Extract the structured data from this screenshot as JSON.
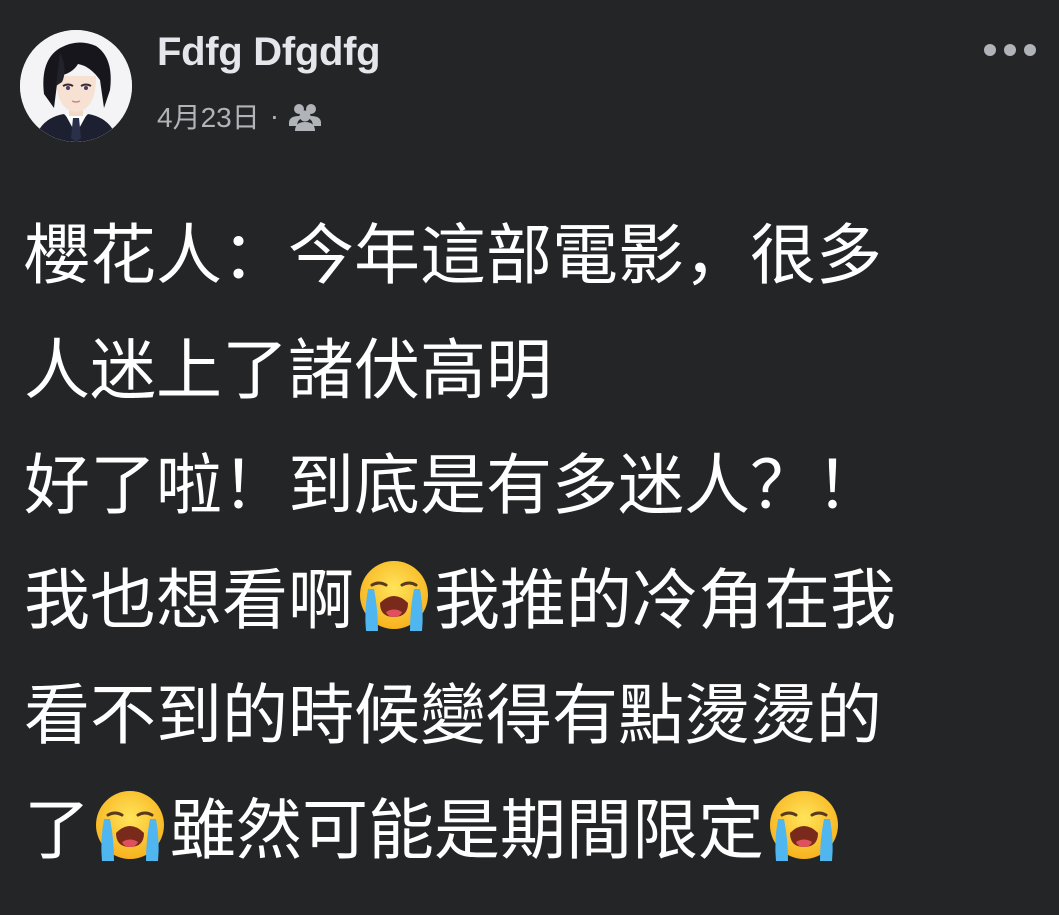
{
  "post": {
    "author_name": "Fdfg Dfgdfg",
    "date": "4月23日",
    "separator": "·",
    "audience_icon": "friends-icon",
    "more_icon": "more-options-icon",
    "emoji": "loudly-crying-face-emoji",
    "lines": [
      {
        "segments": [
          "櫻花人：今年這部電影，很多"
        ]
      },
      {
        "segments": [
          "人迷上了諸伏高明"
        ]
      },
      {
        "segments": [
          "好了啦！到底是有多迷人？！"
        ]
      },
      {
        "segments": [
          "我也想看啊",
          "我推的冷角在我"
        ]
      },
      {
        "segments": [
          "看不到的時候變得有點燙燙的"
        ]
      },
      {
        "segments": [
          "了",
          "雖然可能是期間限定",
          ""
        ]
      }
    ]
  },
  "colors": {
    "background": "#242526",
    "primary_text": "#e4e6eb",
    "secondary_text": "#b0b3b8",
    "body_text": "#ffffff"
  }
}
